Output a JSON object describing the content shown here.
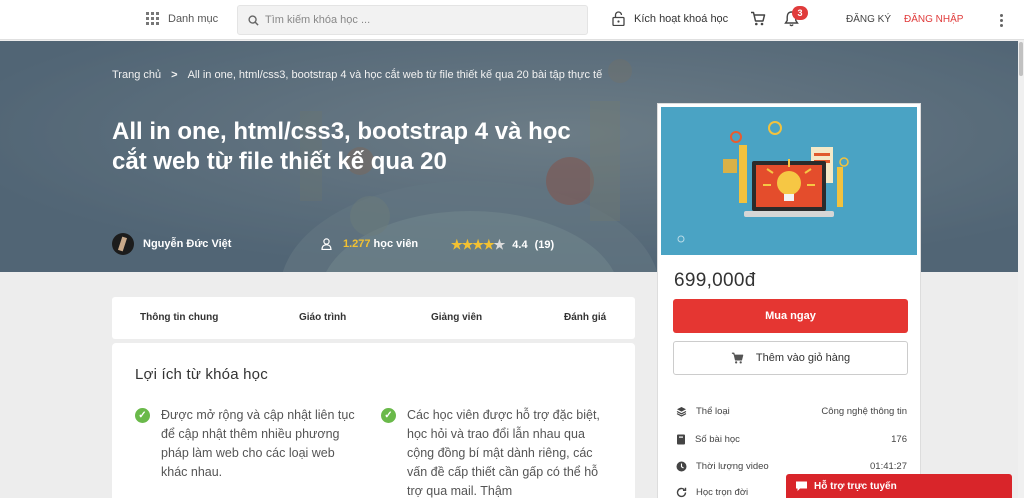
{
  "header": {
    "category_label": "Danh mục",
    "search_placeholder": "Tìm kiếm khóa học ...",
    "activate_label": "Kích hoạt khoá học",
    "notification_count": "3",
    "signup_label": "ĐĂNG KÝ",
    "login_label": "ĐĂNG NHẬP",
    "accent_color": "#e03b3b"
  },
  "hero": {
    "breadcrumb_home": "Trang chủ",
    "breadcrumb_separator": ">",
    "breadcrumb_current": "All in one, html/css3, bootstrap 4 và học cắt web từ file thiết kế qua 20 bài tập thực tế",
    "title": "All in one, html/css3, bootstrap 4 và học cắt web từ file thiết kế qua 20",
    "author_name": "Nguyễn Đức Việt",
    "students_count": "1.277",
    "students_label": "học viên",
    "rating": "4.4",
    "rating_count": "(19)",
    "rating_value": 4.4,
    "rating_max": 5
  },
  "tabs": {
    "items": [
      "Thông tin chung",
      "Giáo trình",
      "Giảng viên",
      "Đánh giá"
    ]
  },
  "benefits": {
    "heading": "Lợi ích từ khóa học",
    "items": [
      "Được mở rộng và cập nhật liên tục để cập nhật thêm nhiều phương pháp làm web cho các loại web khác nhau.",
      "Các học viên được hỗ trợ đặc biệt, học hỏi và trao đổi lẫn nhau qua cộng đồng bí mật dành riêng, các vấn đề cấp thiết cần gấp có thể hỗ trợ qua mail. Thậm"
    ]
  },
  "card": {
    "price": "699,000đ",
    "buy_label": "Mua ngay",
    "add_cart_label": "Thêm vào giỏ hàng",
    "info": [
      {
        "icon": "layers-icon",
        "label": "Thể loại",
        "value": "Công nghệ thông tin"
      },
      {
        "icon": "book-icon",
        "label": "Số bài học",
        "value": "176"
      },
      {
        "icon": "clock-icon",
        "label": "Thời lượng video",
        "value": "01:41:27"
      },
      {
        "icon": "refresh-icon",
        "label": "Học trọn đời",
        "value": ""
      }
    ],
    "buy_color": "#e53632"
  },
  "chat": {
    "label": "Hỗ trợ trực tuyến",
    "color": "#d9252a"
  }
}
